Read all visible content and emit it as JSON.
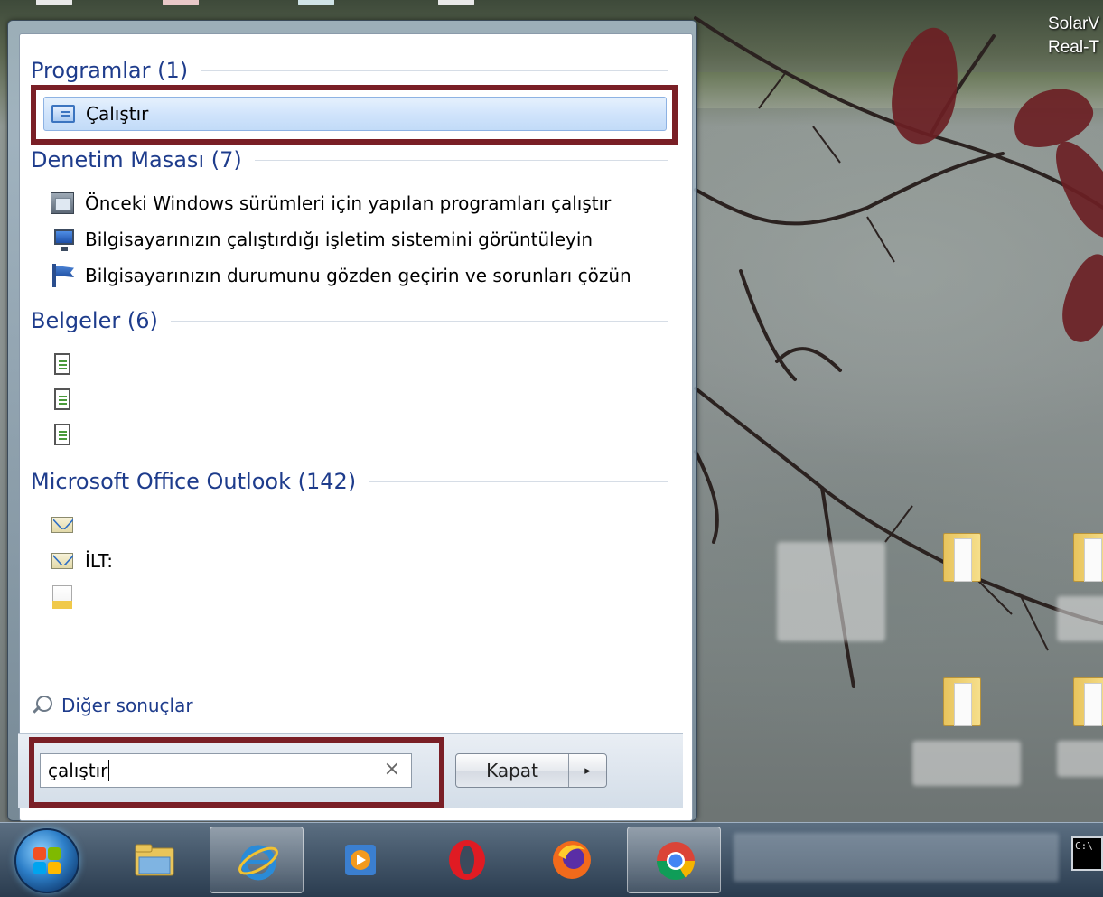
{
  "desktop": {
    "corner_text_line1": "SolarV",
    "corner_text_line2": "Real-T"
  },
  "start_menu": {
    "sections": [
      {
        "title": "Programlar (1)",
        "items": [
          {
            "label": "Çalıştır",
            "icon": "run-icon",
            "selected": true
          }
        ]
      },
      {
        "title": "Denetim Masası (7)",
        "items": [
          {
            "label": "Önceki Windows sürümleri için yapılan programları çalıştır",
            "icon": "compatibility-icon"
          },
          {
            "label": "Bilgisayarınızın çalıştırdığı işletim sistemini görüntüleyin",
            "icon": "system-monitor-icon"
          },
          {
            "label": "Bilgisayarınızın durumunu gözden geçirin ve sorunları çözün",
            "icon": "action-center-flag-icon"
          }
        ]
      },
      {
        "title": "Belgeler (6)",
        "items": [
          {
            "label": "",
            "icon": "document-icon"
          },
          {
            "label": "",
            "icon": "document-icon"
          },
          {
            "label": "",
            "icon": "document-icon"
          }
        ]
      },
      {
        "title": "Microsoft Office Outlook (142)",
        "items": [
          {
            "label": "",
            "icon": "mail-icon"
          },
          {
            "label": "İLT:",
            "icon": "mail-icon"
          },
          {
            "label": "",
            "icon": "note-icon"
          }
        ]
      }
    ],
    "other_results": "Diğer sonuçlar",
    "search": {
      "value": "çalıştır",
      "clear_symbol": "×"
    },
    "shutdown": {
      "label": "Kapat",
      "arrow": "▸"
    }
  },
  "taskbar": {
    "buttons": [
      {
        "name": "windows-explorer",
        "icon": "explorer-folder-icon"
      },
      {
        "name": "internet-explorer",
        "icon": "internet-explorer-icon",
        "active": true
      },
      {
        "name": "media-player",
        "icon": "media-player-icon"
      },
      {
        "name": "opera",
        "icon": "opera-icon"
      },
      {
        "name": "firefox",
        "icon": "firefox-icon"
      },
      {
        "name": "chrome",
        "icon": "chrome-icon",
        "active": true
      }
    ],
    "cmd_text": "C:\\"
  },
  "colors": {
    "highlight_border": "#7a1f26",
    "header_text": "#1e3c8c",
    "selection_fill": "#cfe3fb"
  }
}
